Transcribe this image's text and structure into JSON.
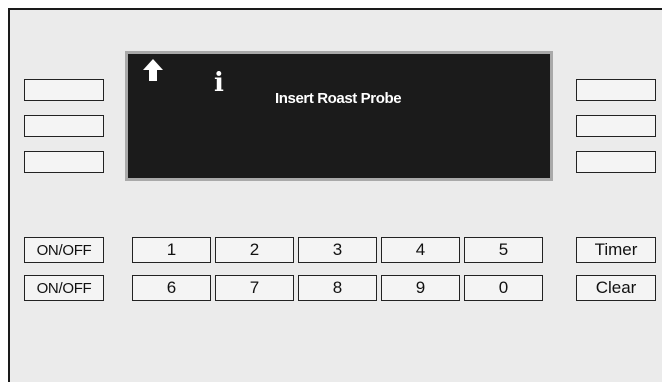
{
  "display": {
    "arrow_icon": "up-arrow-icon",
    "info_glyph": "i",
    "message": "Insert Roast Probe",
    "background": "#1b1b1b",
    "text_color": "#ffffff"
  },
  "soft_keys": {
    "left": [
      "",
      "",
      ""
    ],
    "right": [
      "",
      "",
      ""
    ]
  },
  "controls": {
    "onoff_upper": "ON/OFF",
    "onoff_lower": "ON/OFF",
    "timer": "Timer",
    "clear": "Clear"
  },
  "keypad": {
    "row1": [
      "1",
      "2",
      "3",
      "4",
      "5"
    ],
    "row2": [
      "6",
      "7",
      "8",
      "9",
      "0"
    ]
  }
}
